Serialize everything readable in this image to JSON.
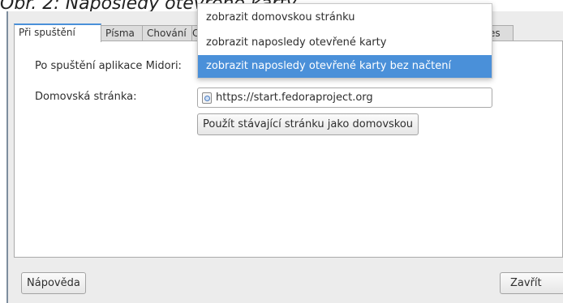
{
  "caption": "Obr. 2: Naposledy otevřené karty",
  "tabs": [
    {
      "label": "Při spuštění"
    },
    {
      "label": "Písma"
    },
    {
      "label": "Chování"
    },
    {
      "label": "es"
    }
  ],
  "startup": {
    "label": "Po spuštění aplikace Midori:",
    "options": [
      "zobrazit domovskou stránku",
      "zobrazit naposledy otevřené karty",
      "zobrazit naposledy otevřené karty bez načtení"
    ],
    "selected_option": "zobrazit naposledy otevřené karty bez načtení"
  },
  "homepage": {
    "label": "Domovská stránka:",
    "value": "https://start.fedoraproject.org",
    "use_current_button": "Použít stávající stránku jako domovskou"
  },
  "buttons": {
    "help": "Nápověda",
    "close": "Zavřít"
  },
  "colors": {
    "accent": "#4a90d9",
    "selection_text": "#ffffff"
  }
}
